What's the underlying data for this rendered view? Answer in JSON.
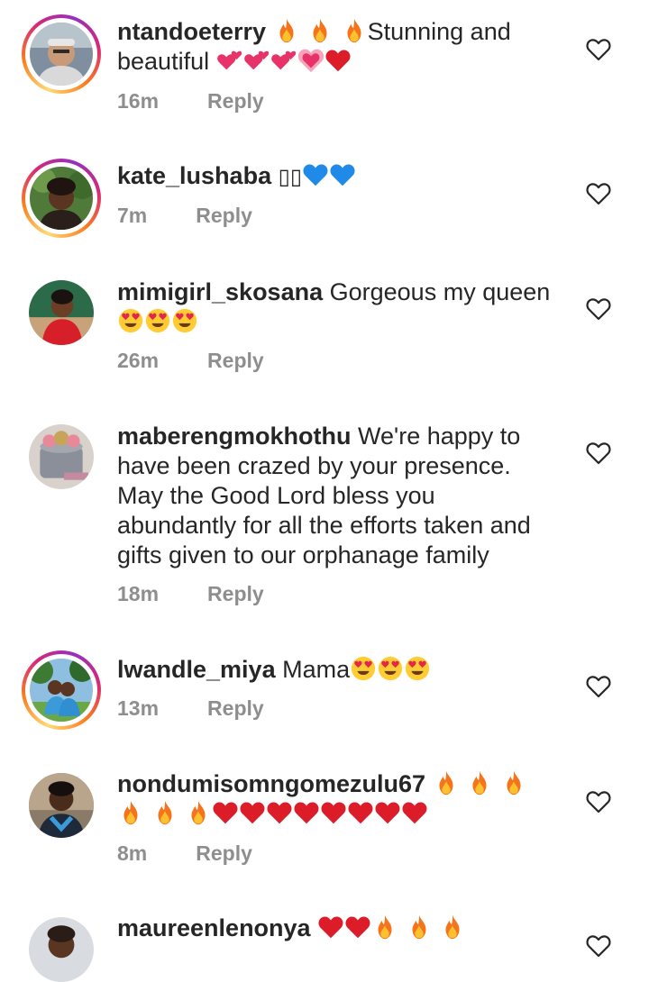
{
  "comments": [
    {
      "username": "ntandoeterry",
      "text": "Stunning and beautiful",
      "time": "16m",
      "reply": "Reply",
      "avatar": "person-avatar",
      "story_ring": true
    },
    {
      "username": "kate_lushaba",
      "text": "",
      "tofu": "▯▯",
      "time": "7m",
      "reply": "Reply",
      "avatar": "person-avatar",
      "story_ring": true
    },
    {
      "username": "mimigirl_skosana",
      "text": "Gorgeous my queen",
      "time": "26m",
      "reply": "Reply",
      "avatar": "person-avatar",
      "story_ring": false
    },
    {
      "username": "maberengmokhothu",
      "text": "We're happy to have been crazed by your presence. May the Good Lord bless you abundantly for all the efforts taken and gifts given to our orphanage family",
      "time": "18m",
      "reply": "Reply",
      "avatar": "cake-avatar",
      "story_ring": false
    },
    {
      "username": "lwandle_miya",
      "text": "Mama",
      "time": "13m",
      "reply": "Reply",
      "avatar": "person-avatar",
      "story_ring": true
    },
    {
      "username": "nondumisomngomezulu67",
      "text": "",
      "time": "8m",
      "reply": "Reply",
      "avatar": "person-avatar",
      "story_ring": false
    },
    {
      "username": "maureenlenonya",
      "text": "",
      "time": "",
      "reply": "",
      "avatar": "person-avatar",
      "story_ring": false
    }
  ],
  "icons": {
    "like": "heart-outline-icon",
    "fire": "fire-emoji",
    "red_heart": "red-heart-emoji",
    "heart_eyes": "heart-eyes-emoji",
    "revolving_hearts": "revolving-hearts-emoji",
    "growing_heart": "growing-heart-emoji",
    "blue_heart": "blue-heart-emoji"
  },
  "colors": {
    "text": "#262626",
    "secondary": "#8e8e8e",
    "story_ring": "#d62976"
  }
}
